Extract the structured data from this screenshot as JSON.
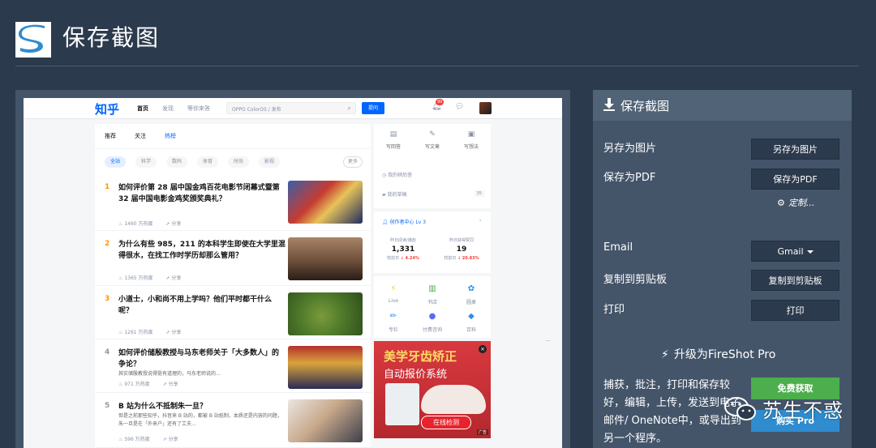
{
  "header": {
    "title": "保存截图"
  },
  "preview": {
    "zhihu": {
      "logo": "知乎",
      "nav": [
        "首页",
        "发现",
        "等你来答"
      ],
      "search_placeholder": "OPPO ColorOS / 发布",
      "ask_label": "提问",
      "notification_count": "99",
      "feed_tabs": [
        "推荐",
        "关注",
        "热榜"
      ],
      "chips": [
        "全站",
        "科学",
        "数码",
        "体育",
        "时尚",
        "影视"
      ],
      "chip_more": "更多",
      "items": [
        {
          "rank": "1",
          "title": "如何评价第 28 届中国金鸡百花电影节闭幕式暨第 32 届中国电影金鸡奖颁奖典礼？",
          "excerpt": "",
          "heat": "1460 万热度",
          "share": "分享"
        },
        {
          "rank": "2",
          "title": "为什么有些 985，211 的本科学生即使在大学里混得很水，在找工作时学历却那么管用？",
          "excerpt": "",
          "heat": "1365 万热度",
          "share": "分享"
        },
        {
          "rank": "3",
          "title": "小道士，小和尚不用上学吗？他们平时都干什么呢？",
          "excerpt": "",
          "heat": "1261 万热度",
          "share": "分享"
        },
        {
          "rank": "4",
          "title": "如何评价储殷教授与马东老师关于「大多数人」的争论？",
          "excerpt": "其实储殷教授说得挺有道理的，马东老师说的…",
          "heat": "971 万热度",
          "share": "分享"
        },
        {
          "rank": "5",
          "title": "B 站为什么不抵制朱一旦？",
          "excerpt": "但是之前那些知乎，抖音来 B 站的，都被 B 站抵制，本质还是内容的问题，朱一旦是在「外来户」还有了工夫…",
          "heat": "596 万热度",
          "share": "分享"
        }
      ],
      "sidebar": {
        "quick_actions": [
          "写回答",
          "写文章",
          "写想法"
        ],
        "rows": [
          "我的稍后答",
          "我的草稿"
        ],
        "drafts_count": "35",
        "creator_center": "创作者中心 Lv 3",
        "stats": [
          {
            "label": "昨日阅读/播放",
            "value": "1,331",
            "delta_label": "较前日",
            "delta": "4.24%"
          },
          {
            "label": "昨日获得赞同",
            "value": "19",
            "delta_label": "较前日",
            "delta": "20.83%"
          }
        ],
        "tools": [
          "Live",
          "书店",
          "圆桌",
          "专栏",
          "付费咨询",
          "百科"
        ],
        "ad_title": "美学牙齿矫正",
        "ad_subtitle": "自动报价系统",
        "ad_button": "在线检测",
        "ad_tag": "广告"
      }
    }
  },
  "panel": {
    "title": "保存截图",
    "rows": [
      {
        "label": "另存为图片",
        "button": "另存为图片"
      },
      {
        "label": "保存为PDF",
        "button": "保存为PDF"
      },
      {
        "label": "Email",
        "button": "Gmail"
      },
      {
        "label": "复制到剪贴板",
        "button": "复制到剪贴板"
      },
      {
        "label": "打印",
        "button": "打印"
      }
    ],
    "custom_link": "定制...",
    "upgrade_title": "升级为FireShot Pro",
    "upgrade_desc": "捕获，批注，打印和保存较好，编辑，上传，发送到电子邮件/ OneNote中，或导出到另一个程序。",
    "free_button": "免费获取",
    "buy_button": "购买 Pro"
  },
  "watermark": {
    "text": "苏生不惑"
  },
  "colors": {
    "background": "#2b3a4c",
    "panel": "#44556a",
    "button": "#2b3a4c",
    "green": "#4cae4c",
    "blue": "#2f8ccf",
    "zhihu_blue": "#0066ff"
  }
}
